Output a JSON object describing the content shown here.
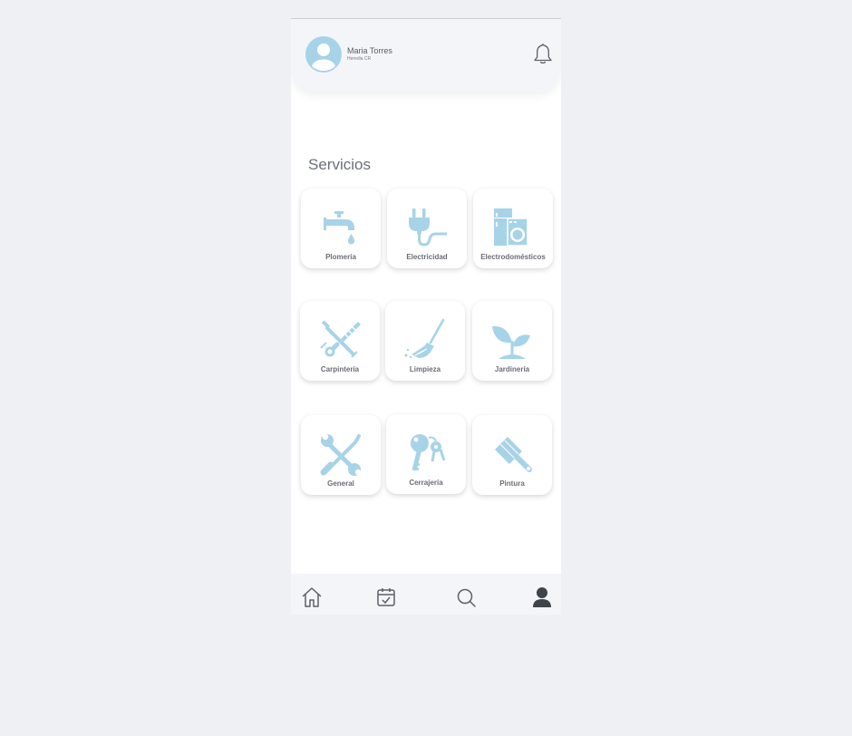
{
  "user": {
    "name": "Maria Torres",
    "location": "Heredia CR"
  },
  "services": {
    "title": "Servicios",
    "items": [
      {
        "label": "Plomería",
        "icon": "faucet-icon"
      },
      {
        "label": "Electricidad",
        "icon": "plug-icon"
      },
      {
        "label": "Electrodomésticos",
        "icon": "appliances-icon"
      },
      {
        "label": "Carpintería",
        "icon": "saw-icon"
      },
      {
        "label": "Limpieza",
        "icon": "broom-icon"
      },
      {
        "label": "Jardinería",
        "icon": "sprout-icon"
      },
      {
        "label": "General",
        "icon": "tools-icon"
      },
      {
        "label": "Cerrajería",
        "icon": "keys-icon"
      },
      {
        "label": "Pintura",
        "icon": "paint-brush-icon"
      }
    ]
  },
  "bottom_nav": [
    "home-icon",
    "calendar-icon",
    "search-icon",
    "profile-icon"
  ],
  "colors": {
    "accent": "#a7d3e8",
    "background": "#eff0f4",
    "header": "#f4f5f9",
    "text": "#6b6e74"
  }
}
